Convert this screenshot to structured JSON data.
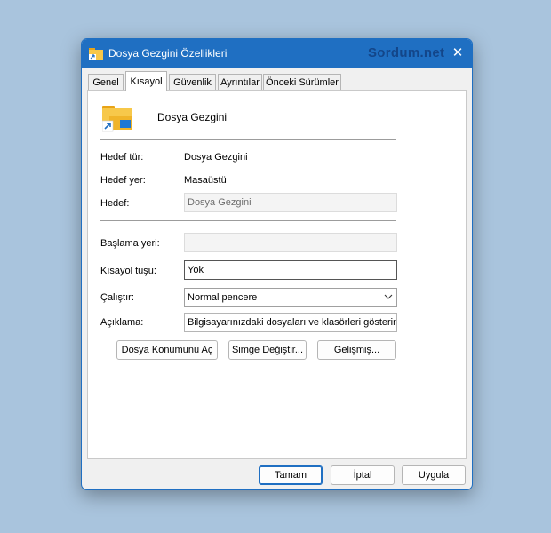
{
  "window": {
    "title": "Dosya Gezgini Özellikleri",
    "watermark": "Sordum.net",
    "close_glyph": "✕",
    "accent": "#1f6fc2"
  },
  "tabs": [
    {
      "label": "Genel"
    },
    {
      "label": "Kısayol",
      "active": true
    },
    {
      "label": "Güvenlik"
    },
    {
      "label": "Ayrıntılar"
    },
    {
      "label": "Önceki Sürümler"
    }
  ],
  "shortcut": {
    "name": "Dosya Gezgini",
    "icon": "folder-shortcut-icon",
    "target_type_label": "Hedef tür:",
    "target_type_value": "Dosya Gezgini",
    "target_location_label": "Hedef yer:",
    "target_location_value": "Masaüstü",
    "target_label": "Hedef:",
    "target_value": "Dosya Gezgini",
    "start_in_label": "Başlama yeri:",
    "start_in_value": "",
    "shortcut_key_label": "Kısayol tuşu:",
    "shortcut_key_value": "Yok",
    "run_label": "Çalıştır:",
    "run_value": "Normal pencere",
    "comment_label": "Açıklama:",
    "comment_value": "Bilgisayarınızdaki dosyaları ve klasörleri gösterir."
  },
  "actions": {
    "open_location": "Dosya Konumunu Aç",
    "change_icon": "Simge Değiştir...",
    "advanced": "Gelişmiş..."
  },
  "footer": {
    "ok": "Tamam",
    "cancel": "İptal",
    "apply": "Uygula"
  },
  "annotation_color": "#e00000"
}
